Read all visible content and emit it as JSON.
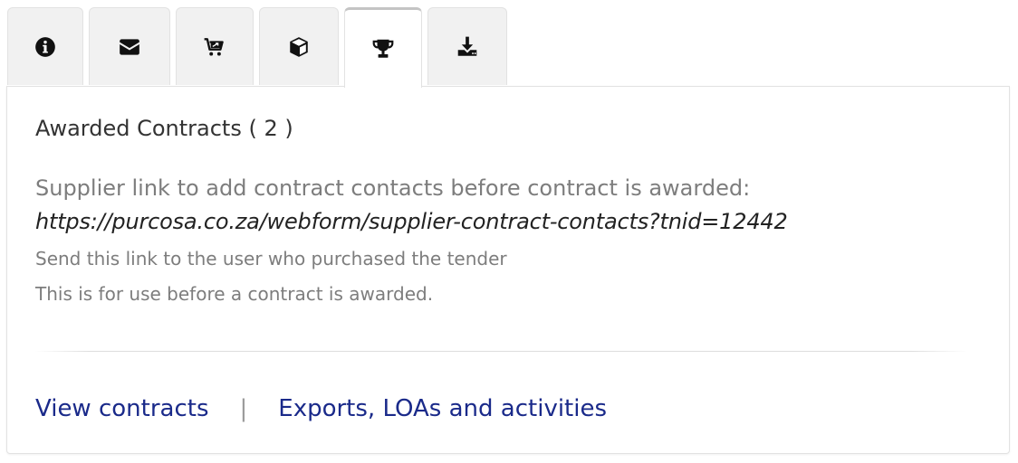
{
  "tabs": [
    {
      "icon": "info-icon",
      "active": false
    },
    {
      "icon": "envelope-icon",
      "active": false
    },
    {
      "icon": "cart-icon",
      "active": false
    },
    {
      "icon": "box-icon",
      "active": false
    },
    {
      "icon": "trophy-icon",
      "active": true
    },
    {
      "icon": "download-icon",
      "active": false
    }
  ],
  "panel": {
    "heading": "Awarded Contracts ( 2 )",
    "supplier_label": "Supplier link to add contract contacts before contract is awarded:",
    "supplier_url": "https://purcosa.co.za/webform/supplier-contract-contacts?tnid=12442",
    "note_send": "Send this link to the user who purchased the tender",
    "note_use": "This is for use before a contract is awarded.",
    "links": {
      "view_contracts": "View contracts",
      "separator": "|",
      "exports": "Exports, LOAs and activities"
    }
  },
  "colors": {
    "link": "#1a2a8a",
    "muted_text": "#7d7d7d",
    "tab_bg": "#f1f1f1"
  }
}
